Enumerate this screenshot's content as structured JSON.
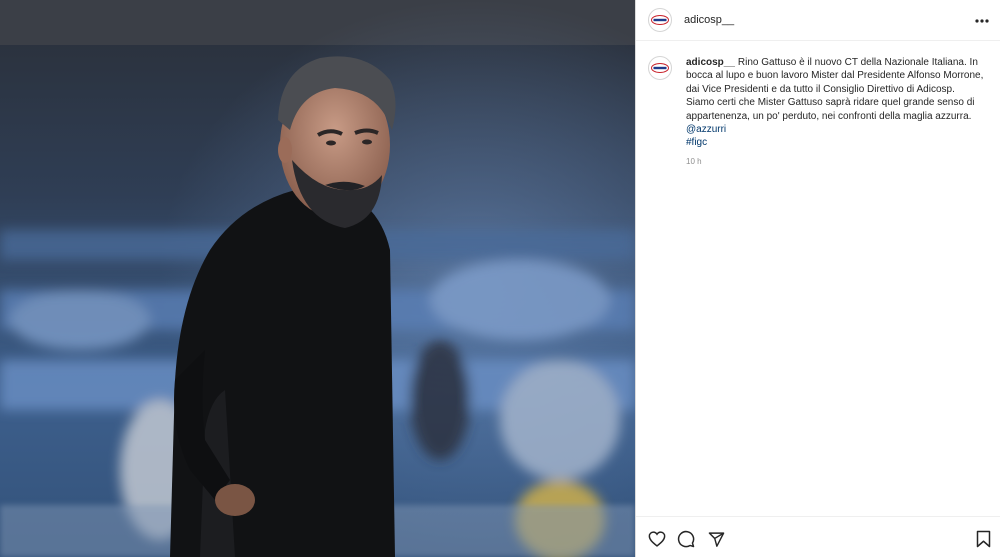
{
  "post": {
    "username": "adicosp__",
    "avatar_icon": "adicosp-logo-icon",
    "more_icon": "more-options-icon"
  },
  "caption": {
    "username": "adicosp__",
    "text": "Rino Gattuso è il nuovo CT della Nazionale Italiana. In bocca al lupo e buon lavoro Mister dal Presidente Alfonso Morrone, dai Vice Presidenti e da tutto il Consiglio Direttivo di Adicosp. Siamo certi che Mister Gattuso saprà ridare quel grande senso di appartenenza, un po' perduto, nei confronti della maglia azzurra.",
    "mention": "@azzurri",
    "hashtag": "#figc",
    "time": "10 h"
  },
  "actions": {
    "like_icon": "heart-icon",
    "comment_icon": "comment-bubble-icon",
    "share_icon": "paper-plane-icon",
    "save_icon": "bookmark-icon"
  },
  "colors": {
    "link": "#00376b",
    "muted": "#8e8e8e",
    "text": "#262626",
    "border": "#dbdbdb"
  }
}
